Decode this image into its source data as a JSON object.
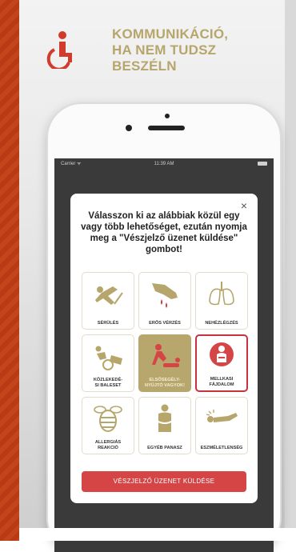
{
  "header": {
    "icon": "wheelchair-icon",
    "title_lines": [
      "KOMMUNIKÁCIÓ,",
      "HA NEM TUDSZ",
      "BESZÉLN"
    ],
    "accent_color": "#b6a66c",
    "icon_color": "#d13b2b"
  },
  "statusbar": {
    "carrier": "Carrier ᯤ",
    "time": "11:39 AM"
  },
  "modal": {
    "close_label": "×",
    "instruction": "Válasszon ki az alábbiak közül egy vagy több lehetőséget, ezután nyomja meg a \"Vészjelző üzenet küldése\" gombot!",
    "tiles": [
      {
        "label": "SÉRÜLÉS",
        "icon": "fall-injury-icon",
        "state": "normal"
      },
      {
        "label": "ERŐS VÉRZÉS",
        "icon": "bleeding-hand-icon",
        "state": "normal"
      },
      {
        "label": "NEHÉZLÉGZÉS",
        "icon": "lungs-icon",
        "state": "normal"
      },
      {
        "label": "KÖZLEKEDÉ-\nSI BALESET",
        "icon": "traffic-accident-icon",
        "state": "normal"
      },
      {
        "label": "ELSŐSEGÉLY-\nNYÚJTÓ VAGYOK!",
        "icon": "first-aid-giver-icon",
        "state": "selected-gold"
      },
      {
        "label": "MELLKASI\nFÁJDALOM",
        "icon": "chest-pain-icon",
        "state": "selected-red"
      },
      {
        "label": "ALLERGIÁS\nREAKCIÓ",
        "icon": "bee-icon",
        "state": "normal"
      },
      {
        "label": "EGYÉB PANASZ",
        "icon": "stomach-ache-icon",
        "state": "normal"
      },
      {
        "label": "ESZMÉLETLENSÉG",
        "icon": "unconscious-icon",
        "state": "normal"
      }
    ],
    "send_label": "VÉSZJELZŐ ÜZENET KÜLDÉSE",
    "send_color": "#d64545"
  }
}
